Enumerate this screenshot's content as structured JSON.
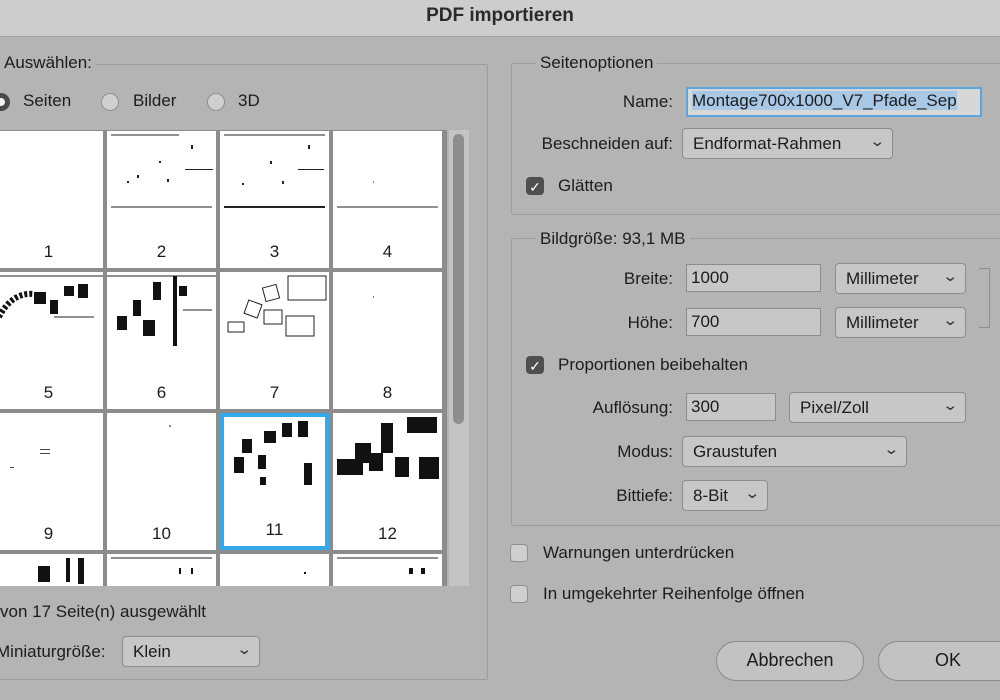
{
  "window": {
    "title": "PDF importieren"
  },
  "select_section": {
    "legend": "Auswählen:",
    "options": [
      {
        "label": "Seiten",
        "selected": true
      },
      {
        "label": "Bilder",
        "selected": false
      },
      {
        "label": "3D",
        "selected": false
      }
    ]
  },
  "thumbnails": {
    "pages": [
      "1",
      "2",
      "3",
      "4",
      "5",
      "6",
      "7",
      "8",
      "9",
      "10",
      "11",
      "12"
    ],
    "selected_page": "11",
    "selection_color": "#31a9ea"
  },
  "selection_status": "von 17 Seite(n) ausgewählt",
  "thumb_size": {
    "label": "Miniaturgröße:",
    "value": "Klein"
  },
  "page_options": {
    "legend": "Seitenoptionen",
    "name_label": "Name:",
    "name_value": "Montage700x1000_V7_Pfade_Sep",
    "crop_label": "Beschneiden auf:",
    "crop_value": "Endformat-Rahmen",
    "smooth_label": "Glätten",
    "smooth_checked": true
  },
  "image_size": {
    "legend": "Bildgröße: 93,1 MB",
    "width_label": "Breite:",
    "width_value": "1000",
    "width_unit": "Millimeter",
    "height_label": "Höhe:",
    "height_value": "700",
    "height_unit": "Millimeter",
    "constrain_label": "Proportionen beibehalten",
    "constrain_checked": true,
    "resolution_label": "Auflösung:",
    "resolution_value": "300",
    "resolution_unit": "Pixel/Zoll",
    "mode_label": "Modus:",
    "mode_value": "Graustufen",
    "bitdepth_label": "Bittiefe:",
    "bitdepth_value": "8-Bit"
  },
  "suppress_warnings": {
    "label": "Warnungen unterdrücken",
    "checked": false
  },
  "reverse_order": {
    "label": "In umgekehrter Reihenfolge öffnen",
    "checked": false
  },
  "buttons": {
    "cancel": "Abbrechen",
    "ok": "OK"
  }
}
